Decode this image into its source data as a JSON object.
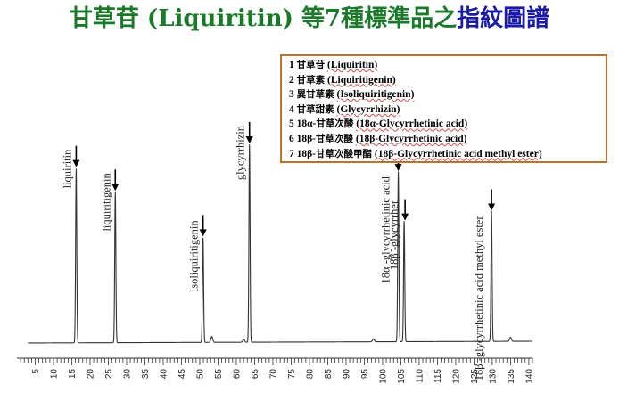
{
  "title": {
    "green": "甘草苷 (Liquiritin) 等7種標準品之",
    "blue": "指紋圖譜"
  },
  "legend": [
    {
      "num": "1",
      "zh": "甘草苷",
      "en": "(Liquiritin)"
    },
    {
      "num": "2",
      "zh": "甘草素",
      "en": "(Liquiritigenin)"
    },
    {
      "num": "3",
      "zh": "異甘草素",
      "en": "(Isoliquiritigenin)"
    },
    {
      "num": "4",
      "zh": "甘草甜素",
      "en": "(Glycyrrhizin)"
    },
    {
      "num": "5 18α-",
      "zh": "甘草次酸",
      "en": "(18α-Glycyrrhetinic acid)"
    },
    {
      "num": "6 18β-",
      "zh": "甘草次酸",
      "en": "(18β-Glycyrrhetinic acid)"
    },
    {
      "num": "7 18β-",
      "zh": "甘草次酸甲酯",
      "en": "(18β-Glycyrrhetinic acid methyl ester)"
    }
  ],
  "chart_data": {
    "type": "line",
    "title": "",
    "xlabel": "",
    "ylabel": "",
    "xlim": [
      0,
      141
    ],
    "x_ticks": [
      5,
      10,
      15,
      20,
      25,
      30,
      35,
      40,
      45,
      50,
      55,
      60,
      65,
      70,
      75,
      80,
      85,
      90,
      95,
      100,
      105,
      110,
      115,
      120,
      125,
      130,
      135,
      140
    ],
    "grid": false,
    "peaks": [
      {
        "label": "liquiritin",
        "x": 16.2,
        "height": 0.88,
        "arrow": true
      },
      {
        "label": "liquiritigenin",
        "x": 26.9,
        "height": 0.76,
        "arrow": true
      },
      {
        "label": "isoliquiritigenin",
        "x": 50.9,
        "height": 0.53,
        "arrow": true
      },
      {
        "label": "glycyrrhizin",
        "x": 63.6,
        "height": 1.0,
        "arrow": true
      },
      {
        "label": "18α -glycyrrhetinic acid",
        "x": 104.3,
        "height": 0.86,
        "arrow": true
      },
      {
        "label": "18β -glycyrrhet",
        "x": 105.9,
        "height": 0.61,
        "arrow": true
      },
      {
        "label": "18β -glycyrrhetinic acid methyl ester",
        "x": 129.8,
        "height": 0.66,
        "arrow": true
      }
    ],
    "minor_peaks": [
      {
        "x": 53.3,
        "height": 0.03
      },
      {
        "x": 62.0,
        "height": 0.015
      },
      {
        "x": 97.5,
        "height": 0.015
      },
      {
        "x": 135.0,
        "height": 0.02
      }
    ]
  }
}
